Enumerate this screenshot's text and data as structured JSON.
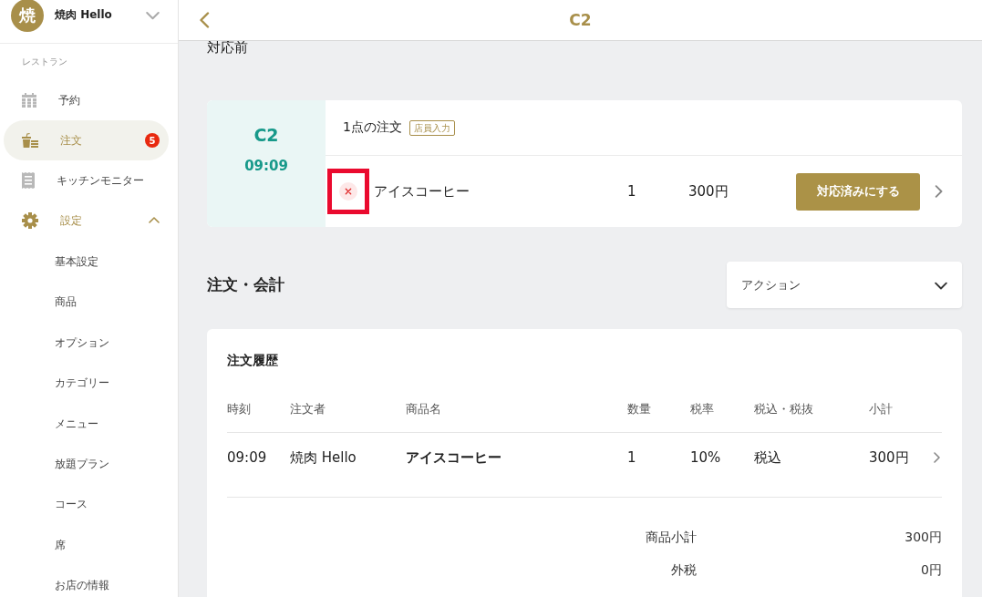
{
  "sidebar": {
    "account": {
      "avatar": "焼",
      "name": "焼肉 Hello"
    },
    "section_label": "レストラン",
    "items": [
      {
        "label": "予約",
        "selected": false
      },
      {
        "label": "注文",
        "selected": true,
        "badge": "5"
      },
      {
        "label": "キッチンモニター",
        "selected": false
      },
      {
        "label": "設定",
        "selected": false,
        "expanded": true,
        "children": [
          {
            "label": "基本設定",
            "selected": false
          },
          {
            "label": "商品",
            "selected": false
          },
          {
            "label": "オプション",
            "selected": false
          },
          {
            "label": "カテゴリー",
            "selected": false
          },
          {
            "label": "メニュー",
            "selected": false
          },
          {
            "label": "放題プラン",
            "selected": false
          },
          {
            "label": "コース",
            "selected": false
          },
          {
            "label": "席",
            "selected": false
          },
          {
            "label": "お店の情報",
            "selected": false
          }
        ]
      }
    ]
  },
  "header": {
    "title": "C2"
  },
  "pending": {
    "title": "対応前",
    "orders": [
      {
        "table": "C2",
        "time": "09:09",
        "summary": "1点の注文",
        "tag": "店員入力",
        "items": [
          {
            "name": "アイスコーヒー",
            "quantity": "1",
            "price": "300円",
            "highlighted": true,
            "button": "対応済みにする"
          }
        ]
      }
    ]
  },
  "orders_billing": {
    "title": "注文・会計",
    "action_select": {
      "label": "アクション"
    },
    "history": {
      "title": "注文履歴",
      "columns": [
        "時刻",
        "注文者",
        "商品名",
        "数量",
        "税率",
        "税込・税抜",
        "小計"
      ],
      "rows": [
        {
          "cells": [
            "09:09",
            "焼肉 Hello",
            "アイスコーヒー",
            "1",
            "10%",
            "税込",
            "300円"
          ]
        }
      ]
    },
    "totals": [
      {
        "label": "商品小計",
        "value": "300円"
      },
      {
        "label": "外税",
        "value": "0円"
      }
    ]
  }
}
